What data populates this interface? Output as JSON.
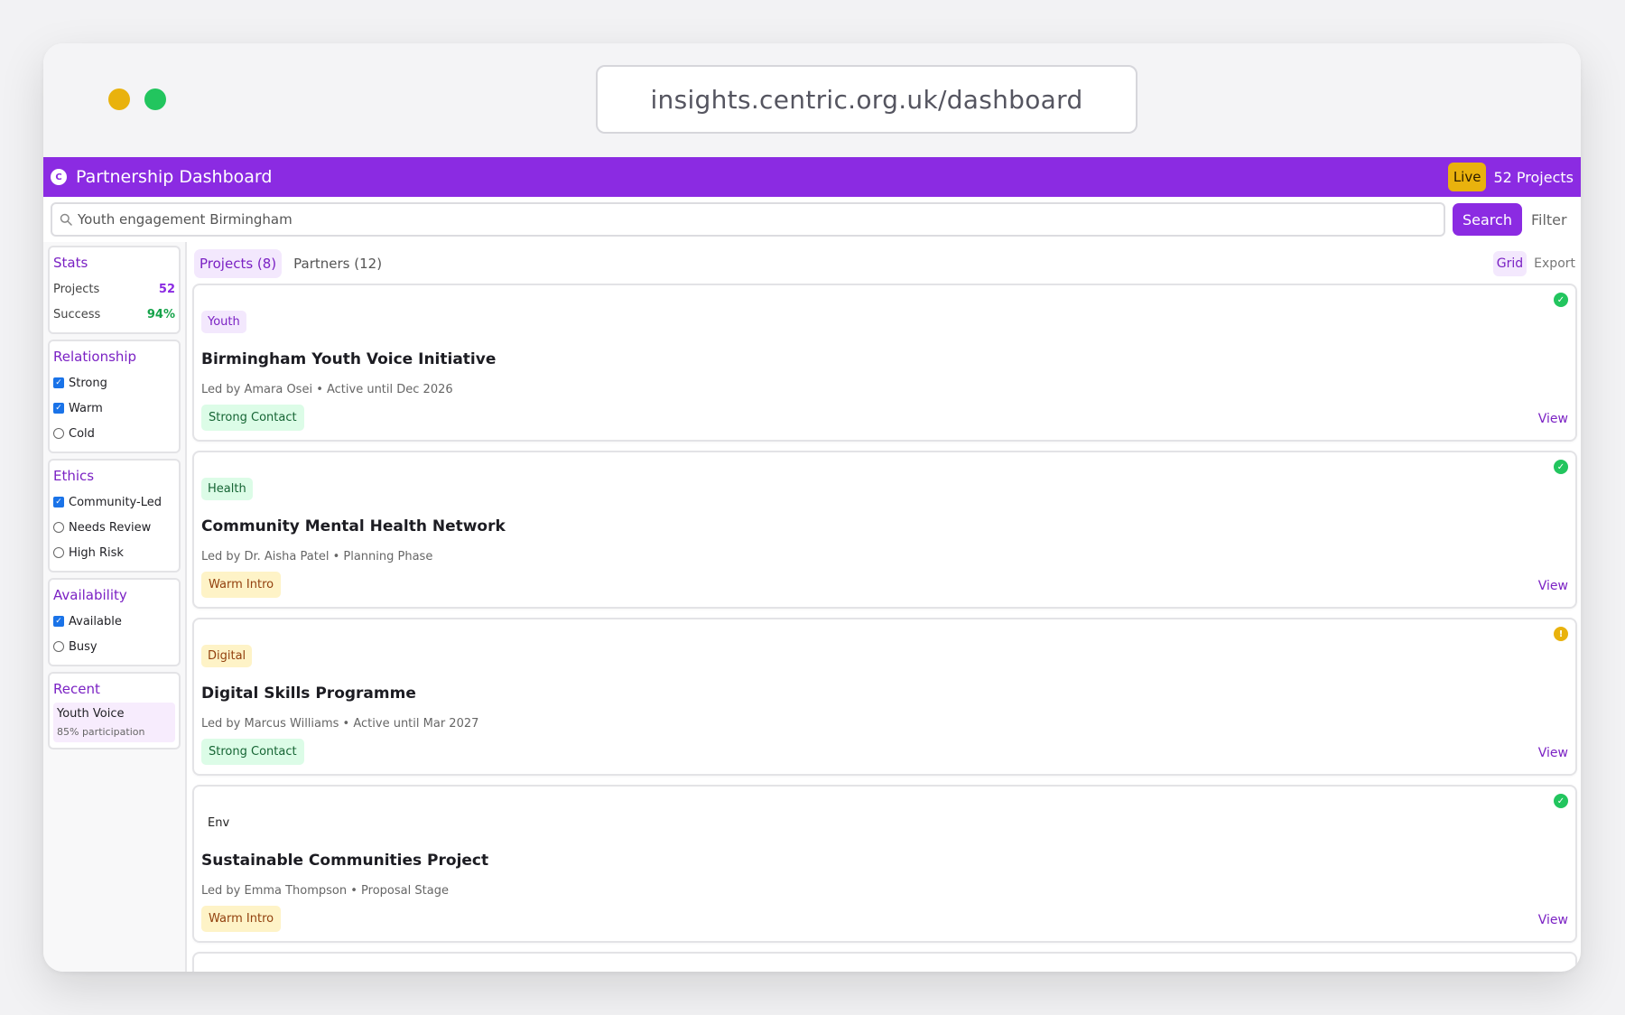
{
  "browser": {
    "url": "insights.centric.org.uk/dashboard"
  },
  "header": {
    "logo_letter": "C",
    "title": "Partnership Dashboard",
    "live_label": "Live",
    "project_count_label": "52 Projects"
  },
  "search": {
    "value": "Youth engagement Birmingham",
    "button_label": "Search",
    "filter_label": "Filter"
  },
  "sidebar": {
    "stats": {
      "title": "Stats",
      "rows": [
        {
          "label": "Projects",
          "value": "52"
        },
        {
          "label": "Success",
          "value": "94%"
        }
      ]
    },
    "relationship": {
      "title": "Relationship",
      "options": [
        {
          "label": "Strong",
          "checked": true
        },
        {
          "label": "Warm",
          "checked": true
        },
        {
          "label": "Cold",
          "checked": false
        }
      ]
    },
    "ethics": {
      "title": "Ethics",
      "options": [
        {
          "label": "Community-Led",
          "checked": true
        },
        {
          "label": "Needs Review",
          "checked": false
        },
        {
          "label": "High Risk",
          "checked": false
        }
      ]
    },
    "availability": {
      "title": "Availability",
      "options": [
        {
          "label": "Available",
          "checked": true
        },
        {
          "label": "Busy",
          "checked": false
        }
      ]
    },
    "recent": {
      "title": "Recent",
      "items": [
        {
          "name": "Youth Voice",
          "detail": "85% participation"
        }
      ]
    }
  },
  "main": {
    "tabs": [
      {
        "label": "Projects (8)",
        "active": true
      },
      {
        "label": "Partners (12)",
        "active": false
      }
    ],
    "grid_label": "Grid",
    "export_label": "Export",
    "cards": [
      {
        "tag": "Youth",
        "title": "Birmingham Youth Voice Initiative",
        "meta": "Led by Amara Osei • Active until Dec 2026",
        "contact": "Strong Contact",
        "status": "check-circle-icon",
        "view_label": "View"
      },
      {
        "tag": "Health",
        "title": "Community Mental Health Network",
        "meta": "Led by Dr. Aisha Patel • Planning Phase",
        "contact": "Warm Intro",
        "status": "check-circle-icon",
        "view_label": "View"
      },
      {
        "tag": "Digital",
        "title": "Digital Skills Programme",
        "meta": "Led by Marcus Williams • Active until Mar 2027",
        "contact": "Strong Contact",
        "status": "warning-circle-icon",
        "view_label": "View"
      },
      {
        "tag": "Env",
        "title": "Sustainable Communities Project",
        "meta": "Led by Emma Thompson • Proposal Stage",
        "contact": "Warm Intro",
        "status": "check-circle-icon",
        "view_label": "View"
      }
    ]
  },
  "colors": {
    "brand": "#8b2be2",
    "live": "#e9b20d",
    "success": "#22c55e"
  }
}
